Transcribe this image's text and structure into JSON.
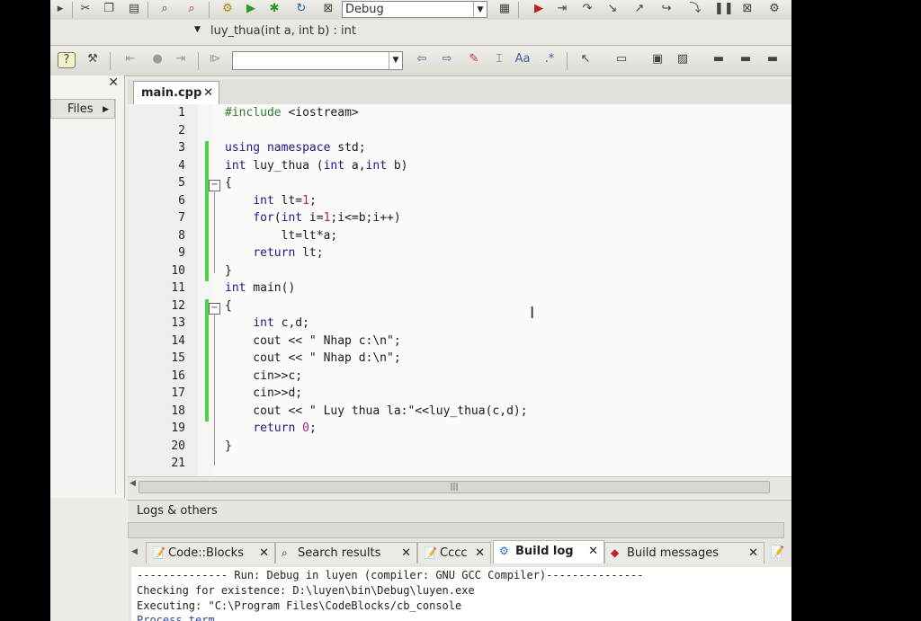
{
  "toolbar": {
    "build_target": "Debug",
    "function_scope": "luy_thua(int a, int b) : int"
  },
  "left_panel": {
    "tab_label": "Files"
  },
  "editor": {
    "tab_label": "main.cpp",
    "lines": [
      {
        "n": "1"
      },
      {
        "n": "2"
      },
      {
        "n": "3"
      },
      {
        "n": "4"
      },
      {
        "n": "5"
      },
      {
        "n": "6"
      },
      {
        "n": "7"
      },
      {
        "n": "8"
      },
      {
        "n": "9"
      },
      {
        "n": "10"
      },
      {
        "n": "11"
      },
      {
        "n": "12"
      },
      {
        "n": "13"
      },
      {
        "n": "14"
      },
      {
        "n": "15"
      },
      {
        "n": "16"
      },
      {
        "n": "17"
      },
      {
        "n": "18"
      },
      {
        "n": "19"
      },
      {
        "n": "20"
      },
      {
        "n": "21"
      }
    ],
    "code": [
      "#include <iostream>",
      "",
      "using namespace std;",
      "int luy_thua (int a,int b)",
      "{",
      "    int lt=1;",
      "    for(int i=1;i<=b;i++)",
      "        lt=lt*a;",
      "    return lt;",
      "}",
      "int main()",
      "{",
      "    int c,d;",
      "    cout << \" Nhap c:\\n\";",
      "    cout << \" Nhap d:\\n\";",
      "    cin>>c;",
      "    cin>>d;",
      "    cout << \" Luy thua la:\"<<luy_thua(c,d);",
      "    return 0;",
      "}",
      ""
    ]
  },
  "logs": {
    "title": "Logs & others",
    "tabs": [
      "Code::Blocks",
      "Search results",
      "Cccc",
      "Build log",
      "Build messages"
    ],
    "active_tab": "Build log",
    "lines": [
      "-------------- Run: Debug in luyen (compiler: GNU GCC Compiler)---------------",
      "Checking for existence: D:\\luyen\\bin\\Debug\\luyen.exe",
      "Executing: \"C:\\Program Files\\CodeBlocks/cb_console",
      "Process term"
    ]
  },
  "colors": {
    "change_bar": "#4fd04f",
    "keyword": "#1a1a8a",
    "number": "#b0207a",
    "preprocessor": "#2f7a2f"
  }
}
